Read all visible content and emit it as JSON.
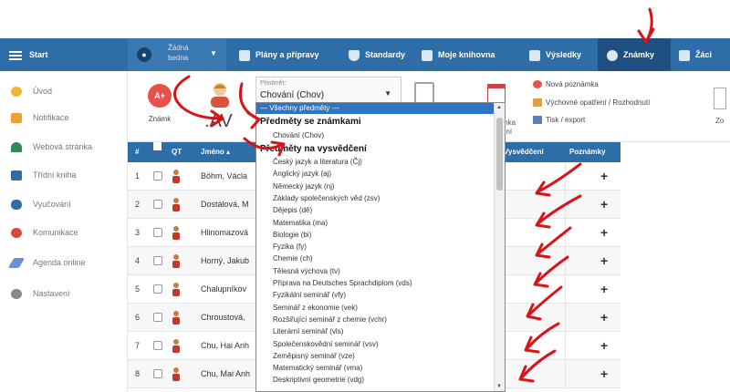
{
  "nav": {
    "start": "Start",
    "school_line1": "Žádná",
    "school_line2": "bedna",
    "items": [
      {
        "label": "Plány a přípravy",
        "icon": "briefcase-icon"
      },
      {
        "label": "Standardy",
        "icon": "shield-icon"
      },
      {
        "label": "Moje knihovna",
        "icon": "library-icon"
      },
      {
        "label": "Výsledky",
        "icon": "bar-chart-icon"
      },
      {
        "label": "Známky",
        "icon": "grade-icon"
      },
      {
        "label": "Žáci",
        "icon": "students-icon"
      }
    ]
  },
  "sidebar": {
    "items": [
      {
        "label": "Úvod",
        "icon": "star-icon",
        "color": "#f2b632"
      },
      {
        "label": "Notifikace",
        "icon": "mail-icon",
        "color": "#f0a030"
      },
      {
        "label": "Webová stránka",
        "icon": "house-icon",
        "color": "#2e8b57"
      },
      {
        "label": "Třídní kniha",
        "icon": "book-icon",
        "color": "#2d6da8"
      },
      {
        "label": "Vyučování",
        "icon": "people-icon",
        "color": "#2d6da8"
      },
      {
        "label": "Komunikace",
        "icon": "chat-icon",
        "color": "#d9463c"
      },
      {
        "label": "Agenda online",
        "icon": "pen-icon",
        "color": "#6b8fd6"
      },
      {
        "label": "Nastavení",
        "icon": "gear-icon",
        "color": "#888888"
      }
    ]
  },
  "toolbar": {
    "znamka_badge": "A+",
    "znamka_label": "Známk",
    "class_label": ".AV",
    "subject_caption": "Předmět:",
    "subject_value": "Chování (Chov)",
    "cal_label1": "mka",
    "cal_label2": "ení",
    "new_note": "Nová poznámka",
    "measures": "Výchovné opatření / Rozhodnutí",
    "print": "Tisk / export",
    "right_label": "Zo"
  },
  "table": {
    "headers": {
      "num": "#",
      "photo": "QT",
      "name": "Jméno ▴",
      "report": "Vysvědčení",
      "notes": "Poznámky"
    },
    "rows": [
      {
        "n": "1",
        "name": "Böhm, Václa"
      },
      {
        "n": "2",
        "name": "Dostálová, M"
      },
      {
        "n": "3",
        "name": "Hlinomazová"
      },
      {
        "n": "4",
        "name": "Horný, Jakub"
      },
      {
        "n": "5",
        "name": "Chalupníkov"
      },
      {
        "n": "6",
        "name": "Chroustová,"
      },
      {
        "n": "7",
        "name": "Chu, Hai Anh"
      },
      {
        "n": "8",
        "name": "Chu, Mai Anh"
      }
    ],
    "plus": "+"
  },
  "dropdown": {
    "all": "— Všechny předměty —",
    "group1": "Předměty se známkami",
    "group1_items": [
      "Chování (Chov)"
    ],
    "group2": "Předměty na vysvědčení",
    "group2_items": [
      "Český jazyk a literatura (Čj)",
      "Anglický jazyk (aj)",
      "Německý jazyk (nj)",
      "Základy společenských věd (zsv)",
      "Dějepis (dě)",
      "Matematika (ma)",
      "Biologie (bi)",
      "Fyzika (fy)",
      "Chemie (ch)",
      "Tělesná výchova (tv)",
      "Příprava na Deutsches Sprachdiplom (vds)",
      "Fyzikální seminář (vfy)",
      "Seminář z ekonomie (vek)",
      "Rozšiřující seminář z chemie (vchr)",
      "Literární seminář (vls)",
      "Společenskovědní seminář (vsv)",
      "Zeměpisný seminář (vze)",
      "Matematický seminář (vma)",
      "Deskriptivní geometrie (vdg)"
    ]
  },
  "colors": {
    "brand": "#2d6da8",
    "accent": "#e8514a",
    "annotation": "#d7141a"
  }
}
